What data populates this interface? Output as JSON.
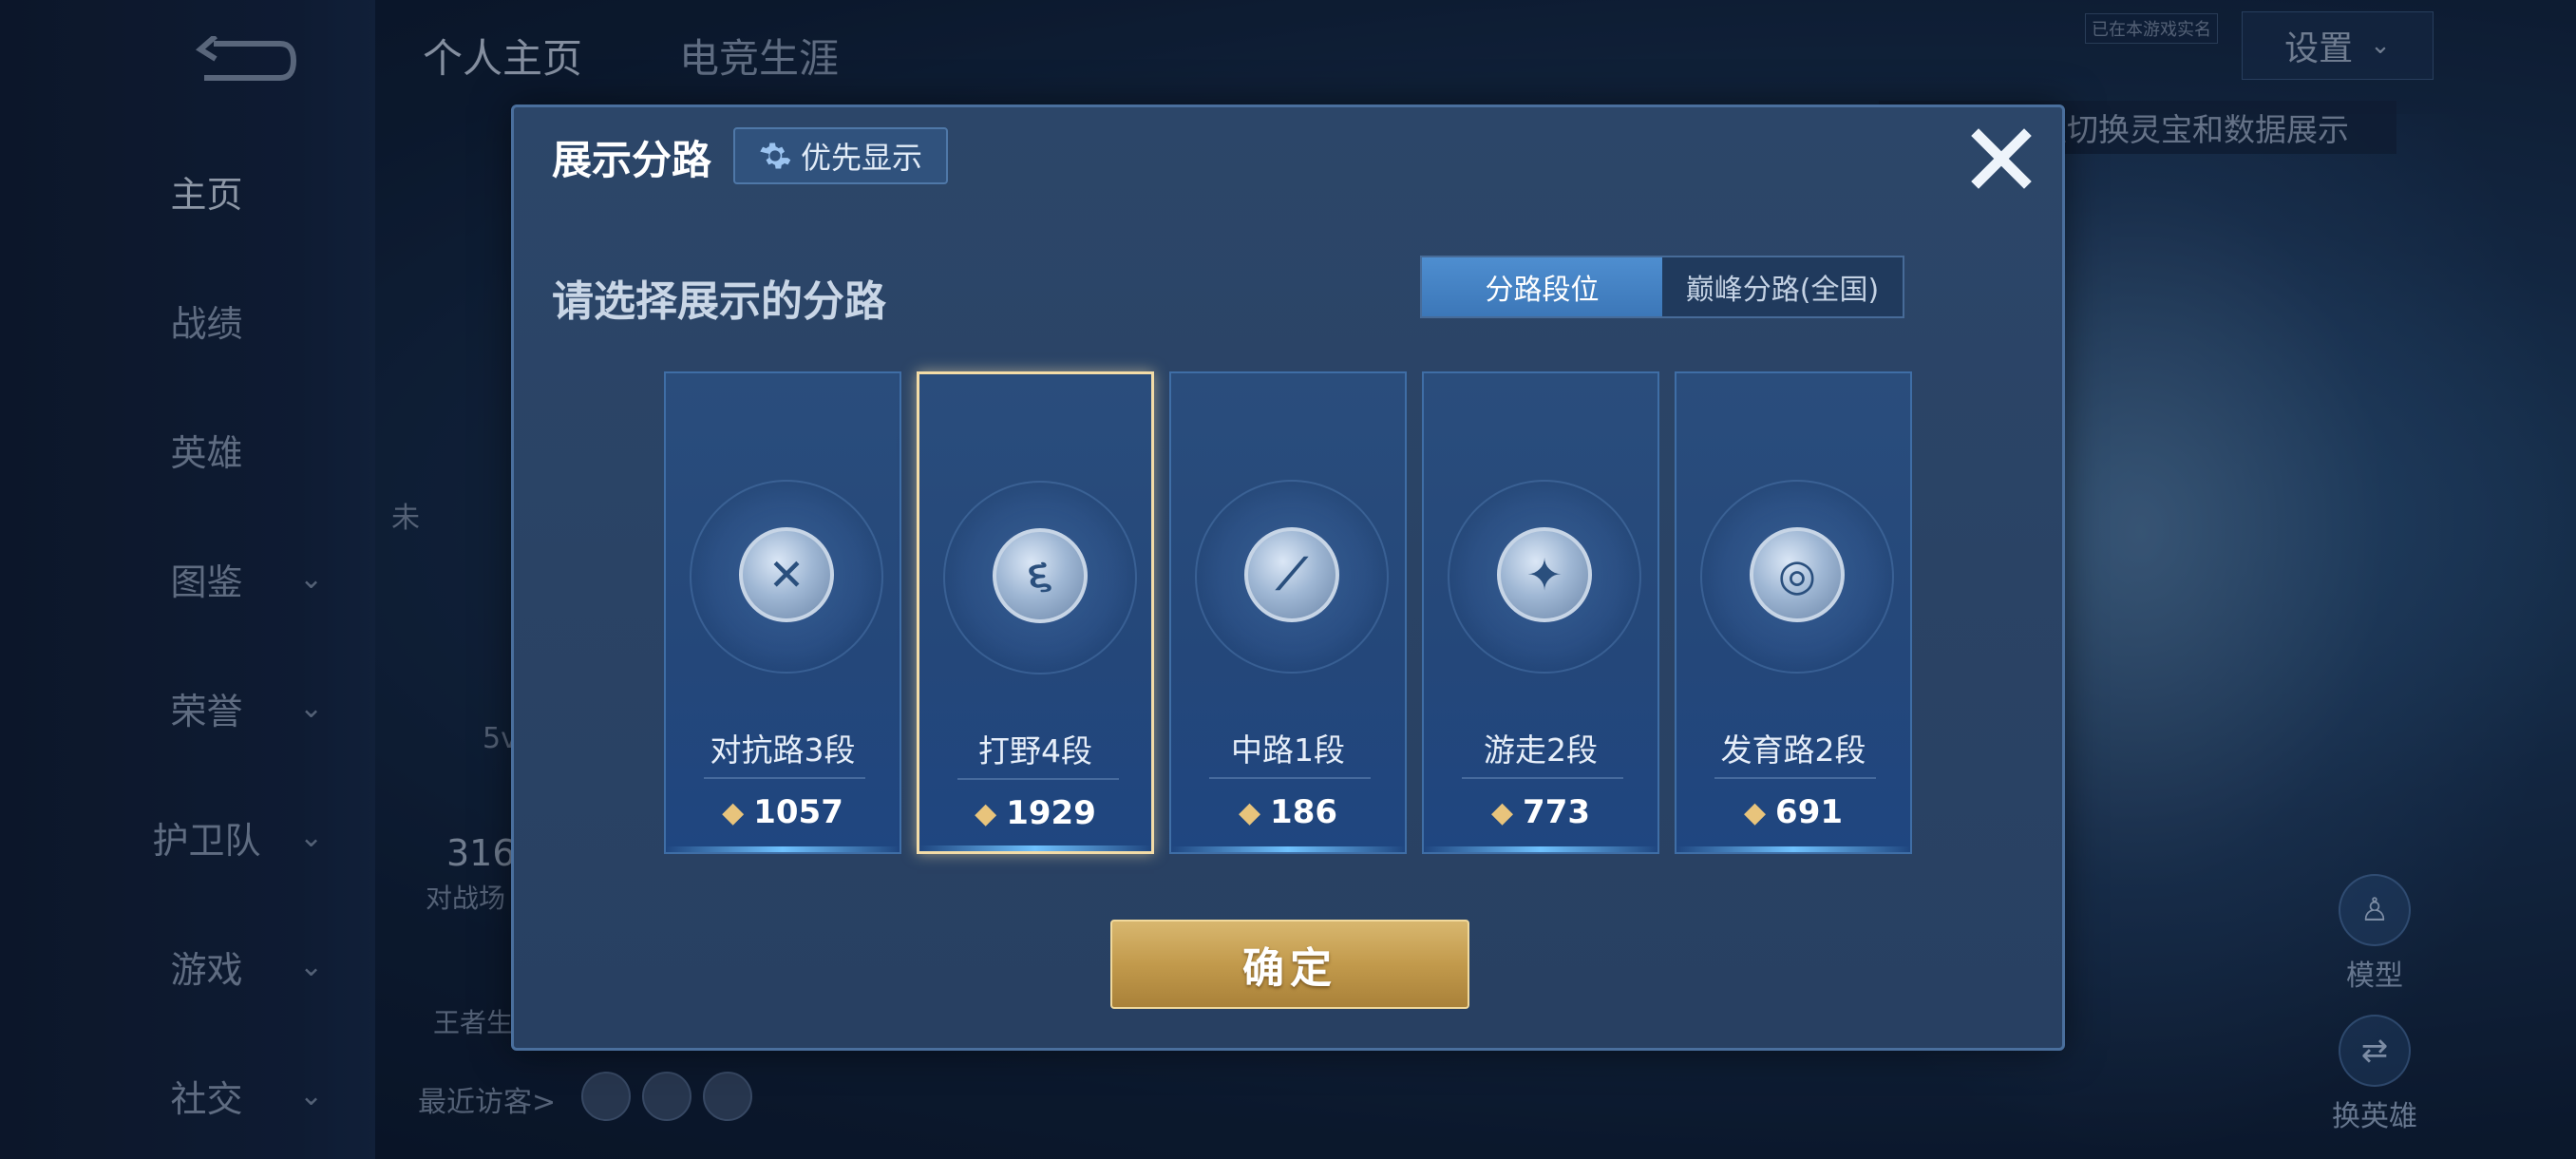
{
  "background": {
    "top_tabs": [
      "个人主页",
      "电竞生涯"
    ],
    "nav_items": [
      {
        "label": "主页",
        "has_chevron": false,
        "active": true
      },
      {
        "label": "战绩",
        "has_chevron": false
      },
      {
        "label": "英雄",
        "has_chevron": false
      },
      {
        "label": "图鉴",
        "has_chevron": true
      },
      {
        "label": "荣誉",
        "has_chevron": true
      },
      {
        "label": "护卫队",
        "has_chevron": true
      },
      {
        "label": "游戏",
        "has_chevron": true
      },
      {
        "label": "社交",
        "has_chevron": true
      }
    ],
    "settings_label": "设置",
    "small_tag": "已在本游戏实名",
    "hint_text": "以切换灵宝和数据展示",
    "partial_texts": {
      "t316": "316",
      "battle": "对战场",
      "wangzhe": "王者生",
      "v5": "5v",
      "wei": "未",
      "recent_visitors": "最近访客>"
    },
    "side_buttons": {
      "model": "模型",
      "change_hero": "换英雄"
    }
  },
  "modal": {
    "title": "展示分路",
    "priority_button": "优先显示",
    "subtitle": "请选择展示的分路",
    "segment_tabs": [
      "分路段位",
      "巅峰分路(全国)"
    ],
    "active_segment": 0,
    "lanes": [
      {
        "name": "对抗路3段",
        "score": "1057",
        "icon": "sword-shield-icon",
        "glyph": "✕",
        "selected": false
      },
      {
        "name": "打野4段",
        "score": "1929",
        "icon": "jungle-dragon-icon",
        "glyph": "૬",
        "selected": true
      },
      {
        "name": "中路1段",
        "score": "186",
        "icon": "mid-wand-icon",
        "glyph": "⟋",
        "selected": false
      },
      {
        "name": "游走2段",
        "score": "773",
        "icon": "wings-icon",
        "glyph": "✦",
        "selected": false
      },
      {
        "name": "发育路2段",
        "score": "691",
        "icon": "bow-target-icon",
        "glyph": "◎",
        "selected": false
      }
    ],
    "confirm_button": "确定"
  },
  "colors": {
    "accent_blue": "#3c77b8",
    "gold": "#c29a4c",
    "selected_border": "#f3dca7"
  }
}
